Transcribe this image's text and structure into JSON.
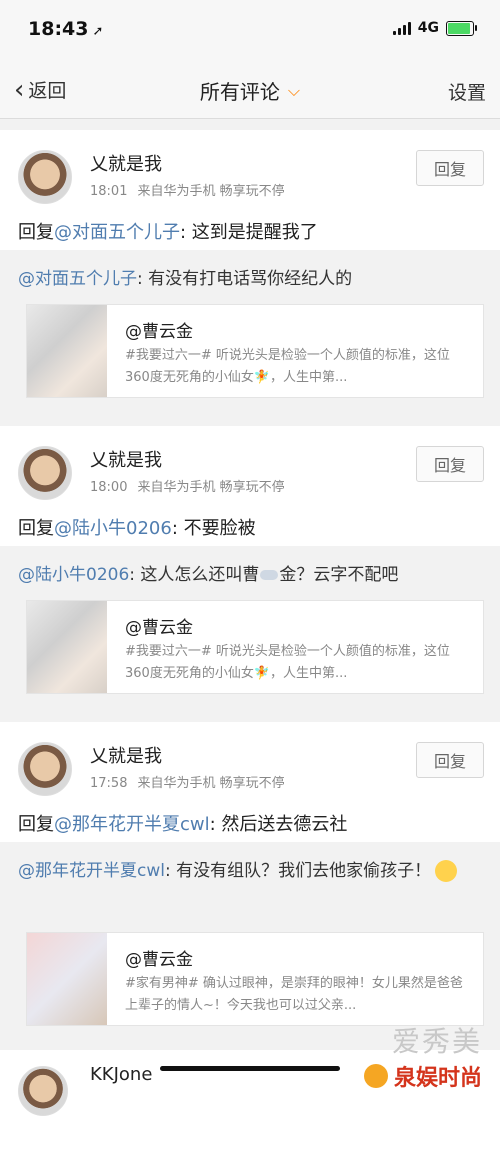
{
  "status_bar": {
    "time": "18:43",
    "network": "4G"
  },
  "nav": {
    "back_label": "返回",
    "title": "所有评论",
    "settings_label": "设置"
  },
  "comments": [
    {
      "user": "乂就是我",
      "time": "18:01",
      "source": "来自华为手机 畅享玩不停",
      "reply_label": "回复",
      "reply_prefix": "回复",
      "mention": "@对面五个儿子",
      "text": ": 这到是提醒我了",
      "quoted_mention": "@对面五个儿子",
      "quoted_text": ": 有没有打电话骂你经纪人的",
      "post_author": "@曹云金",
      "post_text": "#我要过六一# 听说光头是检验一个人颜值的标准，这位360度无死角的小仙女🧚，人生中第..."
    },
    {
      "user": "乂就是我",
      "time": "18:00",
      "source": "来自华为手机 畅享玩不停",
      "reply_label": "回复",
      "reply_prefix": "回复",
      "mention": "@陆小牛0206",
      "text": ": 不要脸被",
      "quoted_mention": "@陆小牛0206",
      "quoted_text_a": ": 这人怎么还叫曹",
      "quoted_text_b": "金？云字不配吧",
      "post_author": "@曹云金",
      "post_text": "#我要过六一# 听说光头是检验一个人颜值的标准，这位360度无死角的小仙女🧚，人生中第..."
    },
    {
      "user": "乂就是我",
      "time": "17:58",
      "source": "来自华为手机 畅享玩不停",
      "reply_label": "回复",
      "reply_prefix": "回复",
      "mention": "@那年花开半夏cwl",
      "text": ": 然后送去德云社",
      "quoted_mention": "@那年花开半夏cwl",
      "quoted_text": ": 有没有组队？我们去他家偷孩子！",
      "post_author": "@曹云金",
      "post_text": "#家有男神# 确认过眼神，是崇拜的眼神！女儿果然是爸爸上辈子的情人~！今天我也可以过父亲..."
    },
    {
      "user": "KKJone"
    }
  ],
  "watermark": {
    "top": "爱秀美",
    "bottom": "泉娱时尚"
  }
}
